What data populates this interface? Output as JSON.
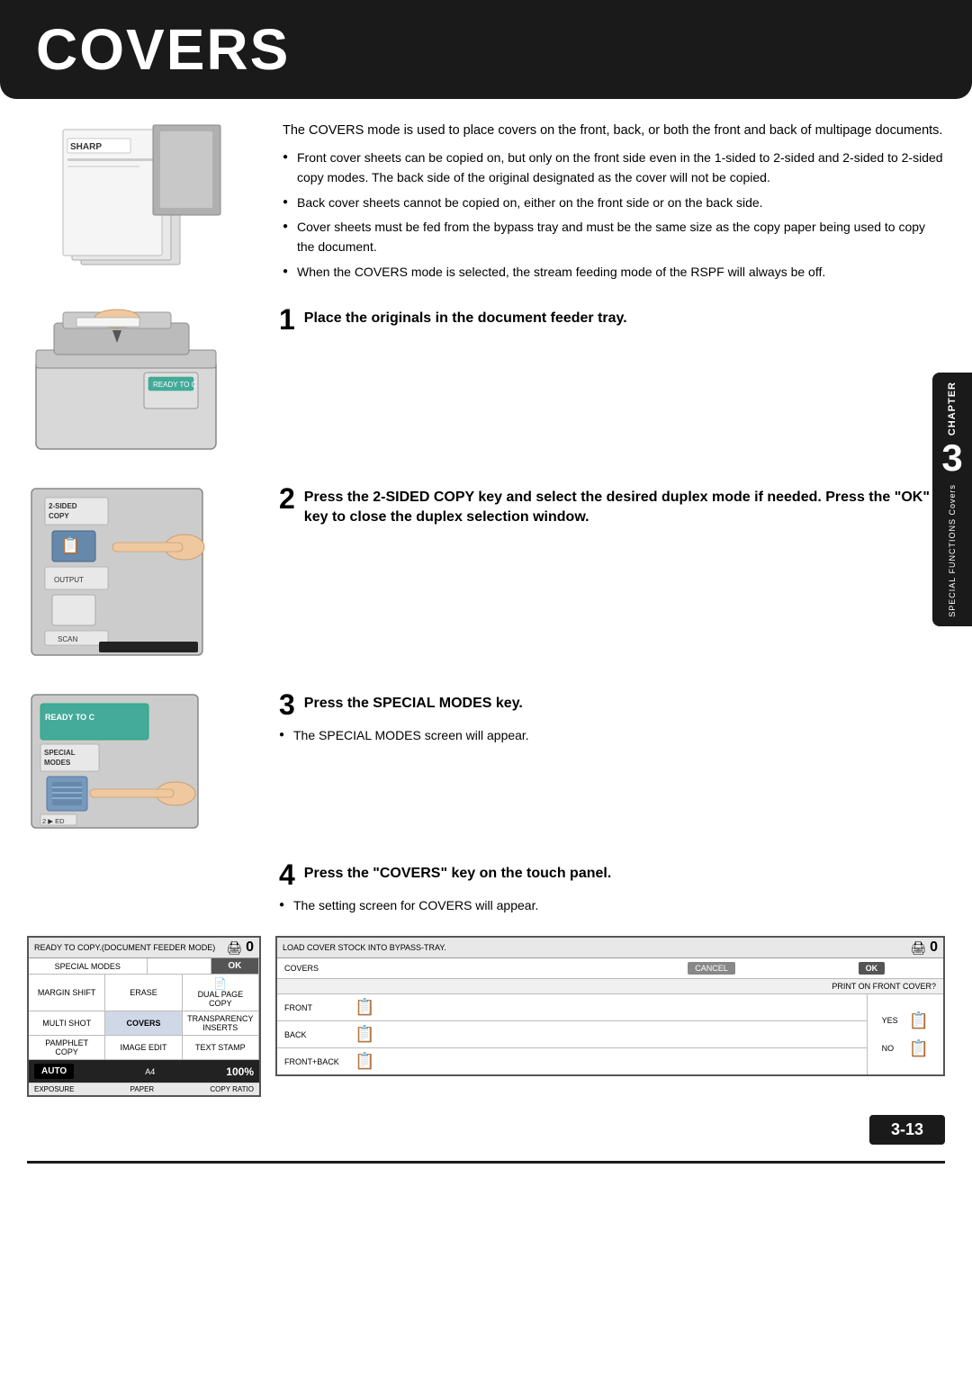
{
  "header": {
    "title": "COVERS"
  },
  "intro": {
    "description": "The COVERS mode is used to place covers on the front, back, or both the front and back of multipage documents.",
    "bullets": [
      "Front cover sheets can be copied on, but only on the front side even in the 1-sided to 2-sided and 2-sided to 2-sided copy modes. The back side of the original designated as the cover will not be copied.",
      "Back cover sheets cannot be copied on, either on the front side or on the back side.",
      "Cover sheets must be fed from the bypass tray and must be the same size as the copy paper being used to copy the document.",
      "When the COVERS mode is selected, the stream feeding mode of the RSPF will always be off."
    ]
  },
  "steps": [
    {
      "num": "1",
      "title": "Place the originals in the document feeder tray.",
      "body": [],
      "has_image": true
    },
    {
      "num": "2",
      "title": "Press the 2-SIDED COPY key and select the desired duplex mode if needed. Press the \"OK\" key to close the duplex selection window.",
      "body": [],
      "has_image": true
    },
    {
      "num": "3",
      "title": "Press the SPECIAL MODES key.",
      "body": [
        "The SPECIAL MODES screen will appear."
      ],
      "has_image": true
    },
    {
      "num": "4",
      "title": "Press the \"COVERS\" key on the touch panel.",
      "body": [
        "The setting screen for COVERS will appear."
      ],
      "has_image": false
    }
  ],
  "chapter": {
    "label": "CHAPTER",
    "number": "3",
    "subtitle": "SPECIAL FUNCTIONS  Covers"
  },
  "page_number": "3-13",
  "left_panel": {
    "top_bar": "READY TO COPY.(DOCUMENT FEEDER MODE)",
    "rows": [
      {
        "cells": [
          "SPECIAL MODES",
          "",
          "OK"
        ]
      },
      {
        "cells": [
          "MARGIN SHIFT",
          "ERASE",
          "DUAL PAGE COPY"
        ]
      },
      {
        "cells": [
          "MULTI SHOT",
          "COVERS",
          "TRANSPARENCY INSERTS"
        ]
      },
      {
        "cells": [
          "PAMPHLET COPY",
          "IMAGE EDIT",
          "TEXT STAMP"
        ]
      }
    ],
    "bottom": {
      "mode": "AUTO",
      "label": "A4",
      "pct": "100%",
      "exposure": "EXPOSURE",
      "paper": "PAPER",
      "ratio": "COPY RATIO"
    }
  },
  "right_panel": {
    "top_bar": "LOAD COVER STOCK INTO BYPASS-TRAY.",
    "covers_label": "COVERS",
    "cancel_btn": "CANCEL",
    "ok_btn": "OK",
    "print_label": "PRINT ON FRONT COVER?",
    "rows": [
      {
        "label": "FRONT"
      },
      {
        "label": "BACK"
      },
      {
        "label": "FRONT+BACK"
      }
    ],
    "yes_label": "YES",
    "no_label": "NO"
  }
}
